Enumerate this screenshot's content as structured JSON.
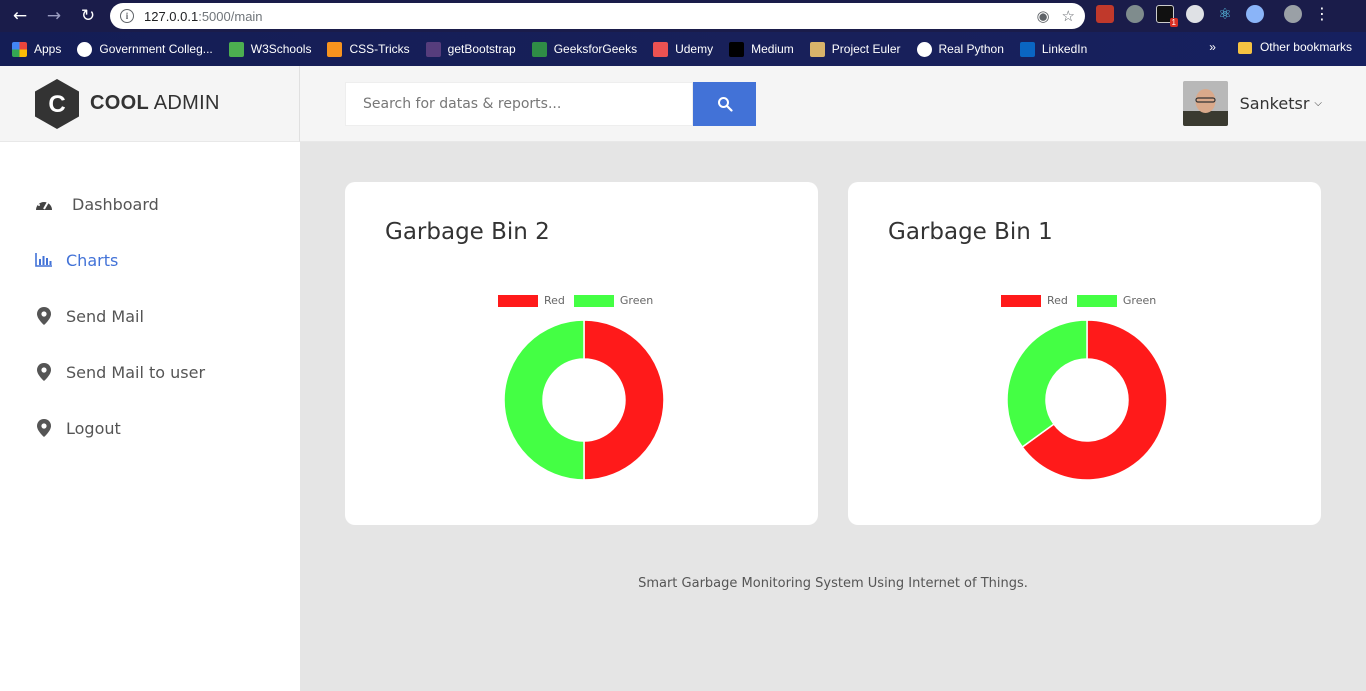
{
  "browser": {
    "url_host": "127.0.0.1",
    "url_path": ":5000/main",
    "ext_badge_count": "1",
    "bookmarks": [
      {
        "label": "Apps",
        "color": "#e8453c"
      },
      {
        "label": "Government Colleg...",
        "color": "#ffffff"
      },
      {
        "label": "W3Schools",
        "color": "#4caf50"
      },
      {
        "label": "CSS-Tricks",
        "color": "#f7931e"
      },
      {
        "label": "getBootstrap",
        "color": "#563d7c"
      },
      {
        "label": "GeeksforGeeks",
        "color": "#2f8d46"
      },
      {
        "label": "Udemy",
        "color": "#ec5252"
      },
      {
        "label": "Medium",
        "color": "#000000"
      },
      {
        "label": "Project Euler",
        "color": "#d8b36a"
      },
      {
        "label": "Real Python",
        "color": "#ffffff"
      },
      {
        "label": "LinkedIn",
        "color": "#0a66c2"
      }
    ],
    "overflow_label": "»",
    "other_bookmarks": "Other bookmarks"
  },
  "brand": {
    "bold": "COOL",
    "light": "ADMIN",
    "letter": "C"
  },
  "search": {
    "placeholder": "Search for datas & reports..."
  },
  "account": {
    "name": "Sanketsr"
  },
  "sidebar": {
    "items": [
      {
        "label": "Dashboard",
        "icon": "tachometer-icon",
        "active": false
      },
      {
        "label": "Charts",
        "icon": "bar-chart-icon",
        "active": true
      },
      {
        "label": "Send Mail",
        "icon": "map-marker-icon",
        "active": false
      },
      {
        "label": "Send Mail to user",
        "icon": "map-marker-icon",
        "active": false
      },
      {
        "label": "Logout",
        "icon": "map-marker-icon",
        "active": false
      }
    ]
  },
  "colors": {
    "accent": "#4272d7",
    "red": "#ff1a1a",
    "green": "#44ff44"
  },
  "chart_data": [
    {
      "type": "pie",
      "variant": "doughnut",
      "title": "Garbage Bin 2",
      "categories": [
        "Red",
        "Green"
      ],
      "values": [
        50,
        50
      ],
      "colors": [
        "#ff1a1a",
        "#44ff44"
      ],
      "legend": "top"
    },
    {
      "type": "pie",
      "variant": "doughnut",
      "title": "Garbage Bin 1",
      "categories": [
        "Red",
        "Green"
      ],
      "values": [
        65,
        35
      ],
      "colors": [
        "#ff1a1a",
        "#44ff44"
      ],
      "legend": "top"
    }
  ],
  "footer": {
    "text": "Smart Garbage Monitoring System Using Internet of Things."
  }
}
